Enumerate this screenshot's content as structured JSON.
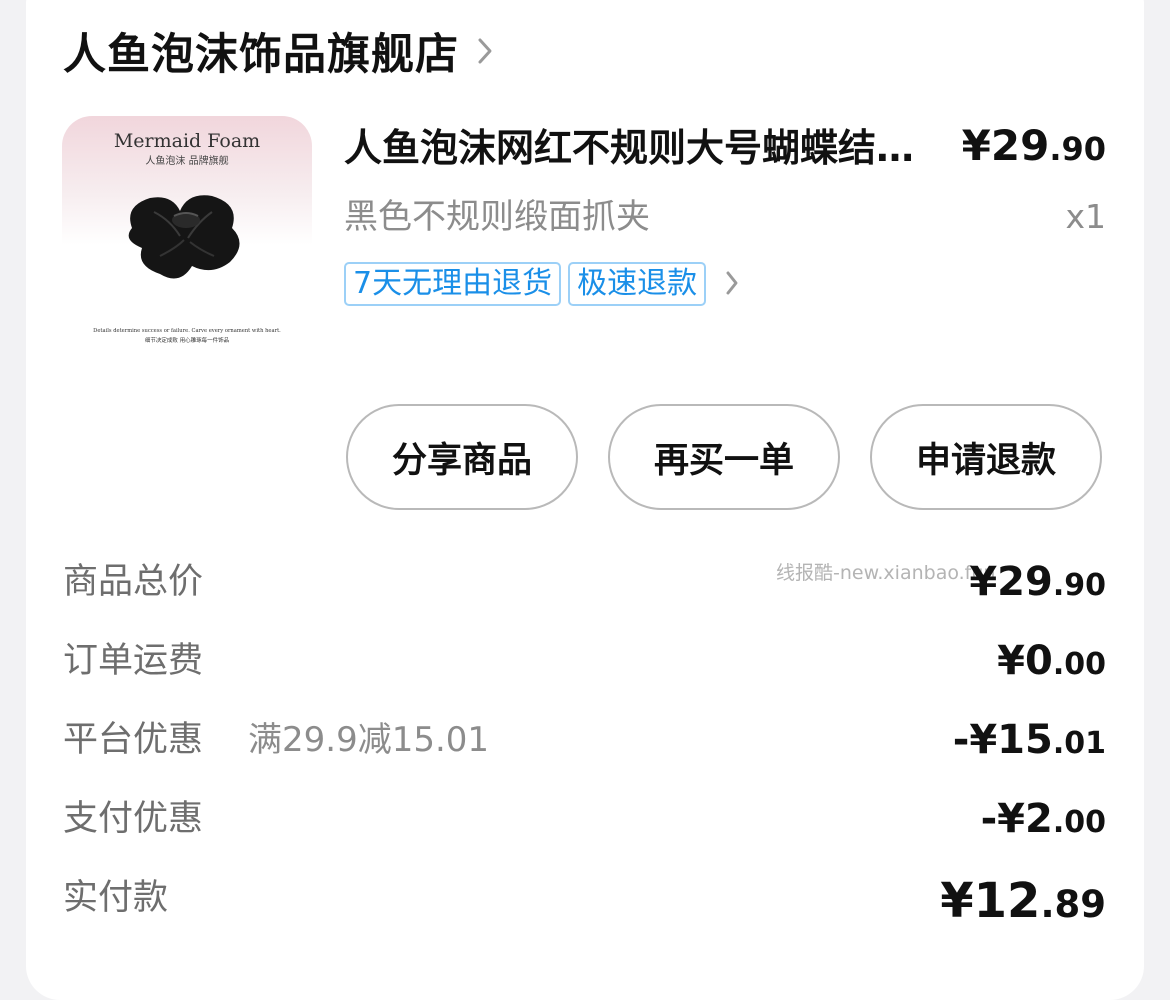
{
  "store": {
    "name": "人鱼泡沫饰品旗舰店",
    "chevron_icon": "chevron-right-icon"
  },
  "product": {
    "image": {
      "brand": "Mermaid Foam",
      "subtitle": "人鱼泡沫  品牌旗舰",
      "caption_en": "Details determine success or failure. Carve every ornament with heart.",
      "caption_cn": "细节决定成败  用心雕琢每一件饰品"
    },
    "title": "人鱼泡沫网红不规则大号蝴蝶结抓夹",
    "price_symbol": "¥",
    "price_int": "29",
    "price_dec": ".90",
    "spec": "黑色不规则缎面抓夹",
    "qty": "x1",
    "tags": [
      "7天无理由退货",
      "极速退款"
    ]
  },
  "actions": {
    "share": "分享商品",
    "rebuy": "再买一单",
    "refund": "申请退款"
  },
  "summary": {
    "goods_total": {
      "label": "商品总价",
      "prefix": "¥",
      "int": "29",
      "dec": ".90"
    },
    "shipping": {
      "label": "订单运费",
      "prefix": "¥",
      "int": "0",
      "dec": ".00"
    },
    "platform_discount": {
      "label": "平台优惠",
      "note": "满29.9减15.01",
      "prefix": "-¥",
      "int": "15",
      "dec": ".01"
    },
    "payment_discount": {
      "label": "支付优惠",
      "prefix": "-¥",
      "int": "2",
      "dec": ".00"
    },
    "paid": {
      "label": "实付款",
      "prefix": "¥",
      "int": "12",
      "dec": ".89"
    }
  },
  "watermark": "线报酷-new.xianbao.fun",
  "colors": {
    "tag_blue": "#1a8fe8",
    "tag_border": "#9cd0f7",
    "text_primary": "#111111",
    "text_secondary": "#8c8c8c"
  }
}
